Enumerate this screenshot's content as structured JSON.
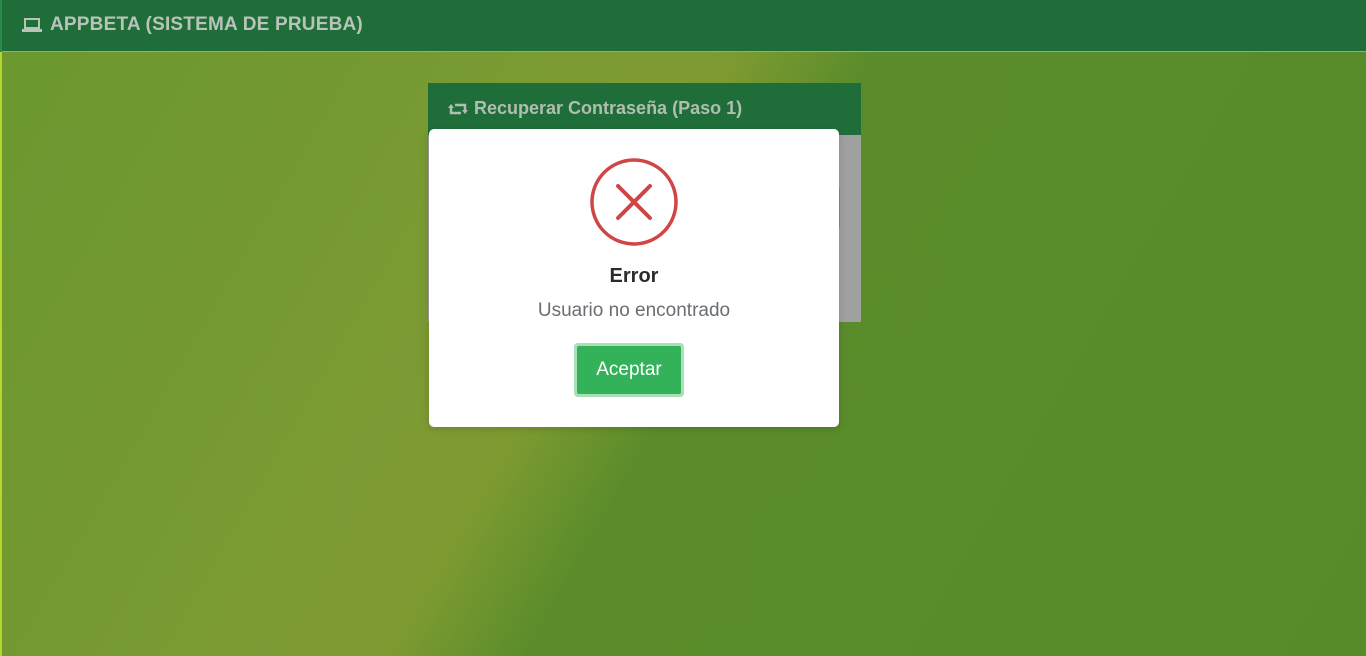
{
  "navbar": {
    "icon": "laptop-icon",
    "title": "APPBETA (SISTEMA DE PRUEBA)"
  },
  "card": {
    "icon": "retweet-icon",
    "title": "Recuperar Contraseña (Paso 1)"
  },
  "modal": {
    "icon": "error-x-icon",
    "title": "Error",
    "message": "Usuario no encontrado",
    "confirm_label": "Aceptar"
  },
  "colors": {
    "navbar_bg": "#1f6e3a",
    "error_red": "#d04545",
    "confirm_green": "#34b25a"
  }
}
